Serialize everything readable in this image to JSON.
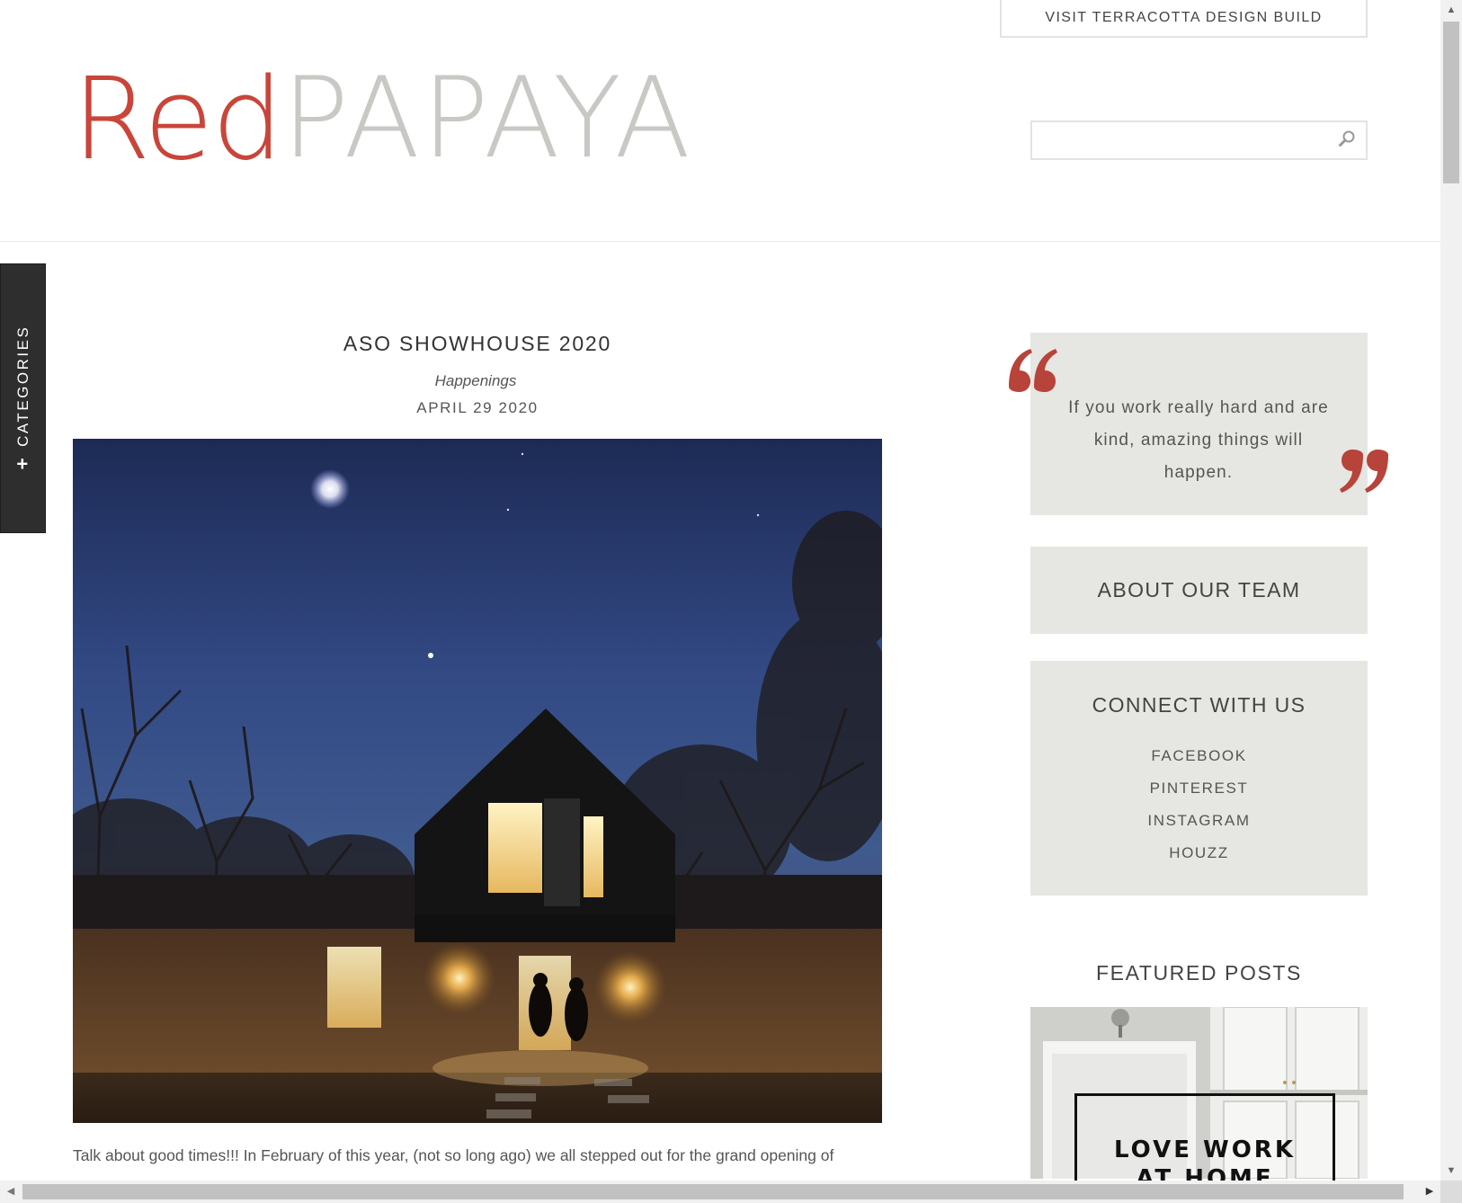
{
  "header": {
    "visit_button": "VISIT TERRACOTTA DESIGN BUILD",
    "logo_red": "Red",
    "logo_papaya": "PAPAYA",
    "search_placeholder": "",
    "search_icon": "magnifier-icon"
  },
  "sidebar_tab": {
    "label": "CATEGORIES",
    "plus": "+"
  },
  "post": {
    "title": "ASO SHOWHOUSE 2020",
    "category": "Happenings",
    "date": "APRIL 29 2020",
    "image_description_icon": "photo",
    "excerpt": "Talk about good times!!! In February of this year, (not so long ago) we all stepped out for the grand opening of"
  },
  "widgets": {
    "quote": {
      "text": "If you work really hard and are kind, amazing things will happen."
    },
    "about": {
      "label": "ABOUT OUR TEAM"
    },
    "connect": {
      "title": "CONNECT WITH US",
      "links": [
        "FACEBOOK",
        "PINTEREST",
        "INSTAGRAM",
        "HOUZZ"
      ]
    },
    "featured": {
      "title": "FEATURED POSTS",
      "thumb_label_line1": "LOVE WORK",
      "thumb_label_line2": "AT HOME"
    }
  },
  "colors": {
    "brand_red": "#c9453a",
    "logo_gray": "#c8c8c4",
    "widget_bg": "#e6e6e2",
    "tab_bg": "#2e2e2e"
  }
}
